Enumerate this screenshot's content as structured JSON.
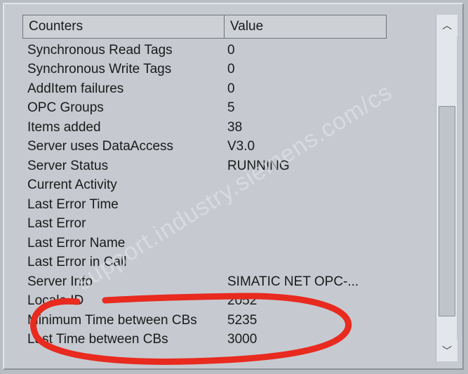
{
  "headers": {
    "counters": "Counters",
    "value": "Value"
  },
  "rows": [
    {
      "counter": "Synchronous Read Tags",
      "value": "0"
    },
    {
      "counter": "Synchronous Write Tags",
      "value": "0"
    },
    {
      "counter": "AddItem failures",
      "value": "0"
    },
    {
      "counter": "OPC Groups",
      "value": "5"
    },
    {
      "counter": "Items added",
      "value": "38"
    },
    {
      "counter": "Server uses DataAccess",
      "value": "V3.0"
    },
    {
      "counter": "Server Status",
      "value": "RUNNING"
    },
    {
      "counter": "Current Activity",
      "value": ""
    },
    {
      "counter": "Last Error Time",
      "value": ""
    },
    {
      "counter": "Last Error",
      "value": ""
    },
    {
      "counter": "Last Error Name",
      "value": ""
    },
    {
      "counter": "Last Error in Call",
      "value": ""
    },
    {
      "counter": "Server Info",
      "value": "SIMATIC NET OPC-..."
    },
    {
      "counter": "Locale ID",
      "value": "2052"
    },
    {
      "counter": "Minimum Time between CBs",
      "value": "5235"
    },
    {
      "counter": "Last Time between CBs",
      "value": "3000"
    }
  ],
  "watermark": "support.industry.siemens.com/cs"
}
